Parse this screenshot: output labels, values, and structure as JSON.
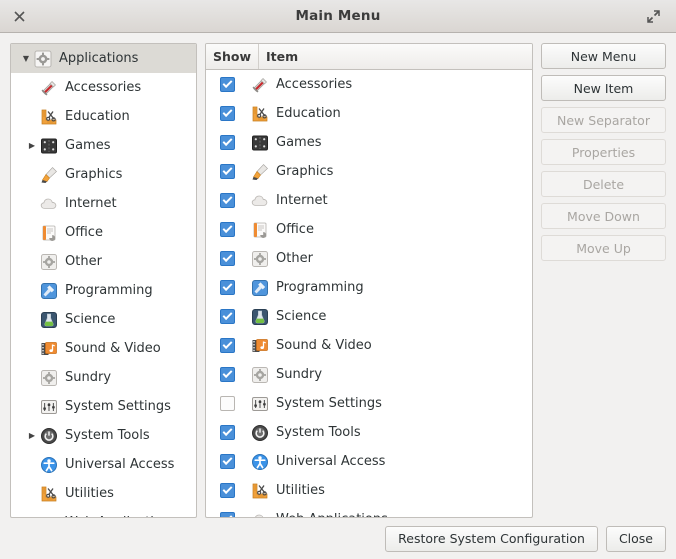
{
  "window": {
    "title": "Main Menu",
    "close_icon": "close-icon",
    "maximize_icon": "maximize-icon"
  },
  "tree": {
    "root": {
      "label": "Applications",
      "icon": "gear-icon",
      "expanded": true,
      "selected": true
    },
    "items": [
      {
        "label": "Accessories",
        "icon": "swiss-knife-icon",
        "expandable": false
      },
      {
        "label": "Education",
        "icon": "ruler-scissors-icon",
        "expandable": false
      },
      {
        "label": "Games",
        "icon": "gameboard-icon",
        "expandable": true
      },
      {
        "label": "Graphics",
        "icon": "paintbrush-icon",
        "expandable": false
      },
      {
        "label": "Internet",
        "icon": "cloud-icon",
        "expandable": false
      },
      {
        "label": "Office",
        "icon": "document-icon",
        "expandable": false
      },
      {
        "label": "Other",
        "icon": "gear-box-icon",
        "expandable": false
      },
      {
        "label": "Programming",
        "icon": "hammer-icon",
        "expandable": false
      },
      {
        "label": "Science",
        "icon": "flask-icon",
        "expandable": false
      },
      {
        "label": "Sound & Video",
        "icon": "film-note-icon",
        "expandable": false
      },
      {
        "label": "Sundry",
        "icon": "gear-box-icon",
        "expandable": false
      },
      {
        "label": "System Settings",
        "icon": "sliders-icon",
        "expandable": false
      },
      {
        "label": "System Tools",
        "icon": "power-icon",
        "expandable": true
      },
      {
        "label": "Universal Access",
        "icon": "accessibility-icon",
        "expandable": false
      },
      {
        "label": "Utilities",
        "icon": "ruler-scissors-icon",
        "expandable": false
      },
      {
        "label": "Web Applications",
        "icon": "cloud-icon",
        "expandable": false
      }
    ]
  },
  "list": {
    "columns": {
      "show": "Show",
      "item": "Item"
    },
    "rows": [
      {
        "label": "Accessories",
        "icon": "swiss-knife-icon",
        "checked": true
      },
      {
        "label": "Education",
        "icon": "ruler-scissors-icon",
        "checked": true
      },
      {
        "label": "Games",
        "icon": "gameboard-icon",
        "checked": true
      },
      {
        "label": "Graphics",
        "icon": "paintbrush-icon",
        "checked": true
      },
      {
        "label": "Internet",
        "icon": "cloud-icon",
        "checked": true
      },
      {
        "label": "Office",
        "icon": "document-icon",
        "checked": true
      },
      {
        "label": "Other",
        "icon": "gear-box-icon",
        "checked": true
      },
      {
        "label": "Programming",
        "icon": "hammer-icon",
        "checked": true
      },
      {
        "label": "Science",
        "icon": "flask-icon",
        "checked": true
      },
      {
        "label": "Sound & Video",
        "icon": "film-note-icon",
        "checked": true
      },
      {
        "label": "Sundry",
        "icon": "gear-box-icon",
        "checked": true
      },
      {
        "label": "System Settings",
        "icon": "sliders-icon",
        "checked": false
      },
      {
        "label": "System Tools",
        "icon": "power-icon",
        "checked": true
      },
      {
        "label": "Universal Access",
        "icon": "accessibility-icon",
        "checked": true
      },
      {
        "label": "Utilities",
        "icon": "ruler-scissors-icon",
        "checked": true
      },
      {
        "label": "Web Applications",
        "icon": "cloud-icon",
        "checked": true
      }
    ]
  },
  "side_buttons": [
    {
      "label": "New Menu",
      "enabled": true
    },
    {
      "label": "New Item",
      "enabled": true
    },
    {
      "label": "New Separator",
      "enabled": false
    },
    {
      "label": "Properties",
      "enabled": false
    },
    {
      "label": "Delete",
      "enabled": false
    },
    {
      "label": "Move Down",
      "enabled": false
    },
    {
      "label": "Move Up",
      "enabled": false
    }
  ],
  "footer": {
    "restore_label": "Restore System Configuration",
    "close_label": "Close"
  },
  "colors": {
    "checkbox_on": "#4a90d9",
    "selection": "#dcdad5",
    "panel_bg": "#ffffff",
    "window_bg": "#f2f1f0"
  }
}
